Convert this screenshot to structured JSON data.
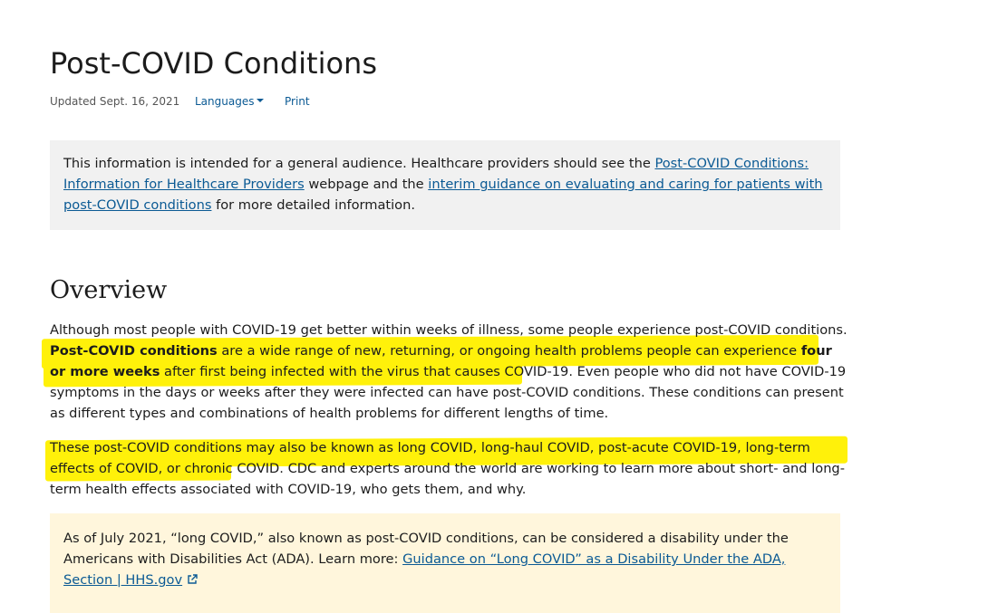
{
  "page": {
    "title": "Post-COVID Conditions",
    "updated": "Updated Sept. 16, 2021",
    "languages_label": "Languages",
    "print_label": "Print"
  },
  "notice": {
    "text_before": "This information is intended for a general audience. Healthcare providers should see the ",
    "link1": "Post-COVID Conditions: Information for Healthcare Providers",
    "text_mid": " webpage and the ",
    "link2": "interim guidance on evaluating and caring for patients with post-COVID conditions",
    "text_after": " for more detailed information."
  },
  "overview": {
    "heading": "Overview",
    "p1_s1": "Although most people with COVID-19 get better within weeks of illness, some people experience post-COVID conditions.",
    "p1_bold1": "Post-COVID conditions",
    "p1_s2": " are a wide range of new, returning, or ongoing health problems people can experience ",
    "p1_bold2": "four or more weeks",
    "p1_s3": " after first being infected with the virus that causes COVID-19",
    "p1_s4": ". Even people who did not have COVID-19 symptoms in the days or weeks after they were infected can have post-COVID conditions. These conditions can present as different types and combinations of health problems for different lengths of time.",
    "p2_s1": "These post-COVID conditions may also be known as long COVID, long-haul COVID, post-acute COVID-19, long-term effects of COVID, or chronic COVID.",
    "p2_s2": " CDC and experts around the world are working to learn more about short- and long-term health effects associated with COVID-19, who gets them, and why."
  },
  "ada_notice": {
    "text": "As of July 2021, “long COVID,” also known as post-COVID conditions, can be considered a disability under the Americans with Disabilities Act (ADA). Learn more: ",
    "link": "Guidance on “Long COVID” as a Disability Under the ADA, Section | HHS.gov",
    "icon": "external-link-icon"
  },
  "colors": {
    "link": "#0b5a94",
    "highlight": "#fff10a",
    "gray_callout": "#f1f1f1",
    "yellow_callout": "#fff6dc"
  }
}
